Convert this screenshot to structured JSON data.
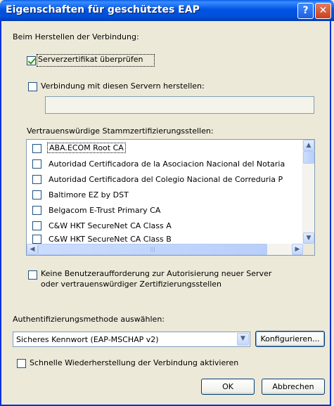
{
  "window": {
    "title": "Eigenschaften für geschütztes EAP",
    "help_glyph": "?",
    "close_glyph": "✕"
  },
  "connect_label": "Beim Herstellen der Verbindung:",
  "verify_cert": {
    "label": "Serverzertifikat überprüfen",
    "checked": true
  },
  "connect_servers": {
    "label": "Verbindung mit diesen Servern herstellen:",
    "checked": false,
    "value": ""
  },
  "trusted_ca": {
    "label": "Vertrauenswürdige Stammzertifizierungsstellen:",
    "items": [
      "ABA.ECOM Root CA",
      "Autoridad Certificadora de la Asociacion Nacional del Notaria",
      "Autoridad Certificadora del Colegio Nacional de Correduria P",
      "Baltimore EZ by DST",
      "Belgacom E-Trust Primary CA",
      "C&W HKT SecureNet CA Class A",
      "C&W HKT SecureNet CA Class B"
    ]
  },
  "scroll_glyphs": {
    "up": "▲",
    "down": "▼",
    "left": "◀",
    "right": "▶",
    "grip": "|||"
  },
  "no_prompt": {
    "line1": "Keine Benutzeraufforderung zur Autorisierung neuer Server",
    "line2": "oder vertrauenswürdiger Zertifizierungsstellen",
    "checked": false
  },
  "auth_method": {
    "label": "Authentifizierungsmethode auswählen:",
    "selected": "Sicheres Kennwort (EAP-MSCHAP v2)",
    "configure_label": "Konfigurieren..."
  },
  "fast_reconnect": {
    "label": "Schnelle Wiederherstellung der Verbindung aktivieren",
    "checked": false
  },
  "buttons": {
    "ok": "OK",
    "cancel": "Abbrechen"
  },
  "colors": {
    "titlebar": "#0054E3",
    "dialog_bg": "#ECE9D8",
    "check": "#21A121",
    "border": "#7F9DB9"
  }
}
